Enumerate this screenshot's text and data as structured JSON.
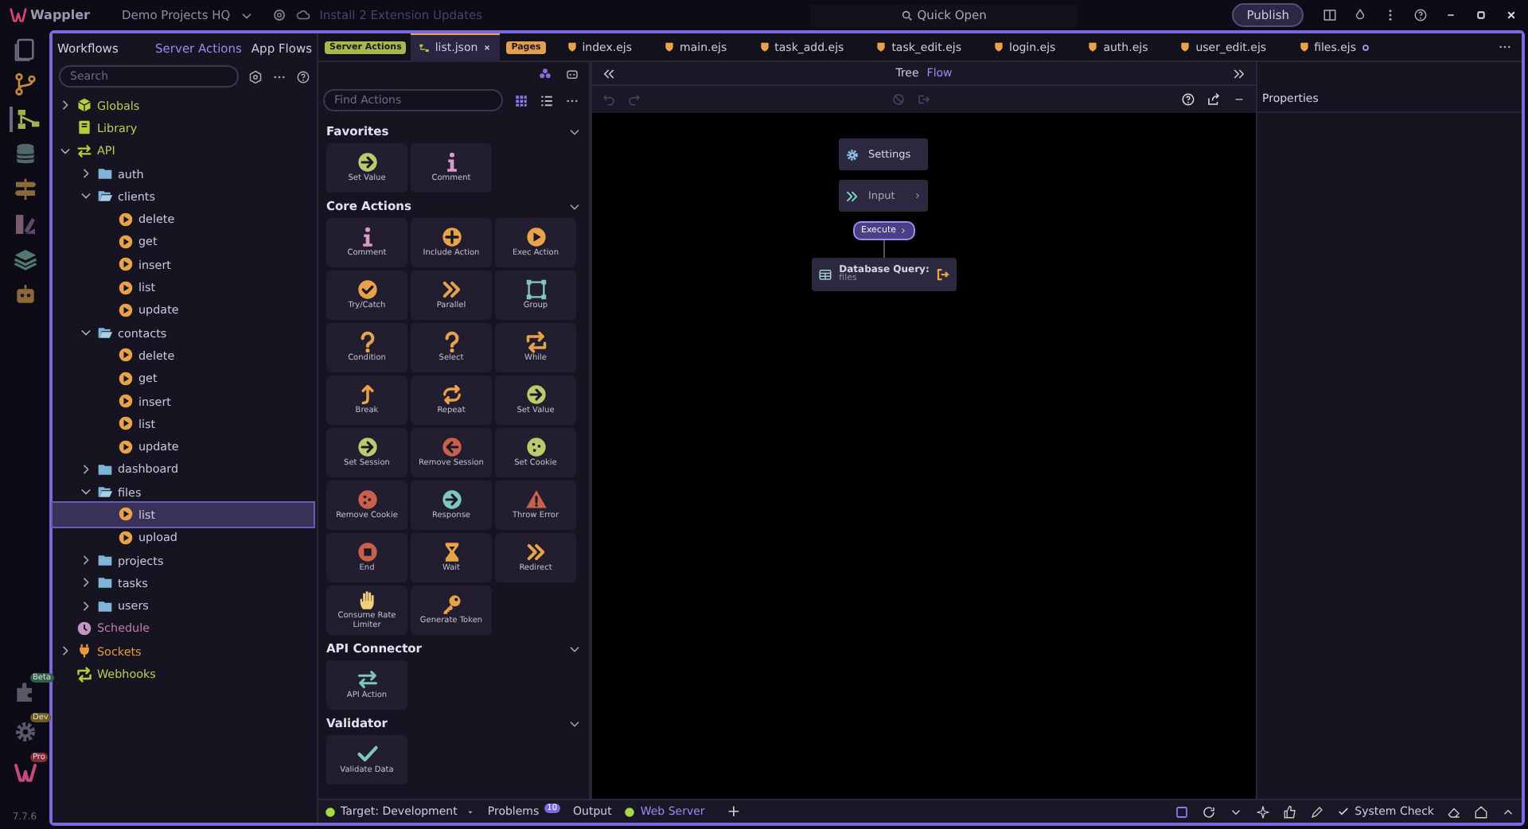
{
  "title_bar": {
    "app_name": "Wappler",
    "project": "Demo Projects HQ",
    "update_notice": "Install 2 Extension Updates",
    "quick_open": "Quick Open",
    "publish": "Publish"
  },
  "activity_bar": {
    "badges": [
      "Beta",
      "Dev",
      "Pro"
    ],
    "version": "7.7.6"
  },
  "workflows": {
    "title": "Workflows",
    "tabs": [
      {
        "label": "Server Actions",
        "selected": true
      },
      {
        "label": "App Flows",
        "selected": false
      }
    ],
    "search": {
      "placeholder": "Search"
    },
    "tree": [
      {
        "kind": "globals",
        "label": "Globals",
        "expanded": false,
        "selected": false
      },
      {
        "kind": "library",
        "label": "Library",
        "selected": false
      },
      {
        "kind": "api",
        "label": "API",
        "expanded": true,
        "selected": false,
        "children": [
          {
            "kind": "folder",
            "label": "auth",
            "expanded": false,
            "selected": false
          },
          {
            "kind": "folder",
            "label": "clients",
            "expanded": true,
            "selected": false,
            "children": [
              {
                "kind": "action",
                "label": "delete",
                "selected": false
              },
              {
                "kind": "action",
                "label": "get",
                "selected": false
              },
              {
                "kind": "action",
                "label": "insert",
                "selected": false
              },
              {
                "kind": "action",
                "label": "list",
                "selected": false
              },
              {
                "kind": "action",
                "label": "update",
                "selected": false
              }
            ]
          },
          {
            "kind": "folder",
            "label": "contacts",
            "expanded": true,
            "selected": false,
            "children": [
              {
                "kind": "action",
                "label": "delete",
                "selected": false
              },
              {
                "kind": "action",
                "label": "get",
                "selected": false
              },
              {
                "kind": "action",
                "label": "insert",
                "selected": false
              },
              {
                "kind": "action",
                "label": "list",
                "selected": false
              },
              {
                "kind": "action",
                "label": "update",
                "selected": false
              }
            ]
          },
          {
            "kind": "folder",
            "label": "dashboard",
            "expanded": false,
            "selected": false
          },
          {
            "kind": "folder",
            "label": "files",
            "expanded": true,
            "selected": false,
            "children": [
              {
                "kind": "action",
                "label": "list",
                "selected": true
              },
              {
                "kind": "action",
                "label": "upload",
                "selected": false
              }
            ]
          },
          {
            "kind": "folder",
            "label": "projects",
            "expanded": false,
            "selected": false
          },
          {
            "kind": "folder",
            "label": "tasks",
            "expanded": false,
            "selected": false
          },
          {
            "kind": "folder",
            "label": "users",
            "expanded": false,
            "selected": false
          }
        ]
      },
      {
        "kind": "schedule",
        "label": "Schedule",
        "selected": false
      },
      {
        "kind": "sockets",
        "label": "Sockets",
        "expanded": false,
        "selected": false
      },
      {
        "kind": "webhooks",
        "label": "Webhooks",
        "selected": false
      }
    ]
  },
  "editor_tabs": [
    {
      "kind": "group",
      "label": "Server Actions"
    },
    {
      "kind": "json",
      "label": "list.json",
      "selected": true,
      "modified": false
    },
    {
      "kind": "pages",
      "label": "Pages"
    },
    {
      "kind": "page",
      "label": "index.ejs",
      "selected": false,
      "modified": false
    },
    {
      "kind": "page",
      "label": "main.ejs",
      "selected": false,
      "modified": false
    },
    {
      "kind": "page",
      "label": "task_add.ejs",
      "selected": false,
      "modified": false
    },
    {
      "kind": "page",
      "label": "task_edit.ejs",
      "selected": false,
      "modified": false
    },
    {
      "kind": "page",
      "label": "login.ejs",
      "selected": false,
      "modified": false
    },
    {
      "kind": "page",
      "label": "auth.ejs",
      "selected": false,
      "modified": false
    },
    {
      "kind": "page",
      "label": "user_edit.ejs",
      "selected": false,
      "modified": false
    },
    {
      "kind": "page",
      "label": "files.ejs",
      "selected": false,
      "modified": true
    }
  ],
  "actions_panel": {
    "search": {
      "placeholder": "Find Actions"
    },
    "sections": [
      {
        "title": "Favorites",
        "expanded": true,
        "actions": [
          {
            "kind": "set-value",
            "label": "Set Value"
          },
          {
            "kind": "comment",
            "label": "Comment"
          }
        ]
      },
      {
        "title": "Core Actions",
        "expanded": true,
        "actions": [
          {
            "kind": "comment",
            "label": "Comment"
          },
          {
            "kind": "include",
            "label": "Include Action"
          },
          {
            "kind": "exec",
            "label": "Exec Action"
          },
          {
            "kind": "try",
            "label": "Try/Catch"
          },
          {
            "kind": "parallel",
            "label": "Parallel"
          },
          {
            "kind": "group",
            "label": "Group"
          },
          {
            "kind": "question",
            "label": "Condition"
          },
          {
            "kind": "question",
            "label": "Select"
          },
          {
            "kind": "loop",
            "label": "While"
          },
          {
            "kind": "break",
            "label": "Break"
          },
          {
            "kind": "repeat",
            "label": "Repeat"
          },
          {
            "kind": "set-value",
            "label": "Set Value"
          },
          {
            "kind": "set-value",
            "label": "Set Session"
          },
          {
            "kind": "remove",
            "label": "Remove Session"
          },
          {
            "kind": "cookie",
            "label": "Set Cookie"
          },
          {
            "kind": "remove-cookie",
            "label": "Remove Cookie"
          },
          {
            "kind": "response",
            "label": "Response"
          },
          {
            "kind": "error",
            "label": "Throw Error"
          },
          {
            "kind": "end",
            "label": "End"
          },
          {
            "kind": "wait",
            "label": "Wait"
          },
          {
            "kind": "parallel",
            "label": "Redirect"
          },
          {
            "kind": "hand",
            "label": "Consume Rate Limiter"
          },
          {
            "kind": "key",
            "label": "Generate Token"
          }
        ]
      },
      {
        "title": "API Connector",
        "expanded": true,
        "actions": [
          {
            "kind": "swap",
            "label": "API Action"
          }
        ]
      },
      {
        "title": "Validator",
        "expanded": true,
        "actions": [
          {
            "kind": "validate",
            "label": "Validate Data"
          }
        ]
      }
    ]
  },
  "flow": {
    "view_tabs": [
      {
        "label": "Tree",
        "selected": false
      },
      {
        "label": "Flow",
        "selected": true
      }
    ],
    "nodes": [
      {
        "kind": "settings",
        "label": "Settings"
      },
      {
        "kind": "input",
        "label": "Input"
      },
      {
        "kind": "execute",
        "label": "Execute"
      },
      {
        "kind": "query",
        "label": "Database Query:",
        "detail": "files"
      }
    ]
  },
  "properties": {
    "title": "Properties"
  },
  "status_bar": {
    "target": "Target: Development",
    "problems": "Problems",
    "problems_count": "10",
    "output": "Output",
    "server": "Web Server",
    "add": "+",
    "system_check": "System Check"
  }
}
